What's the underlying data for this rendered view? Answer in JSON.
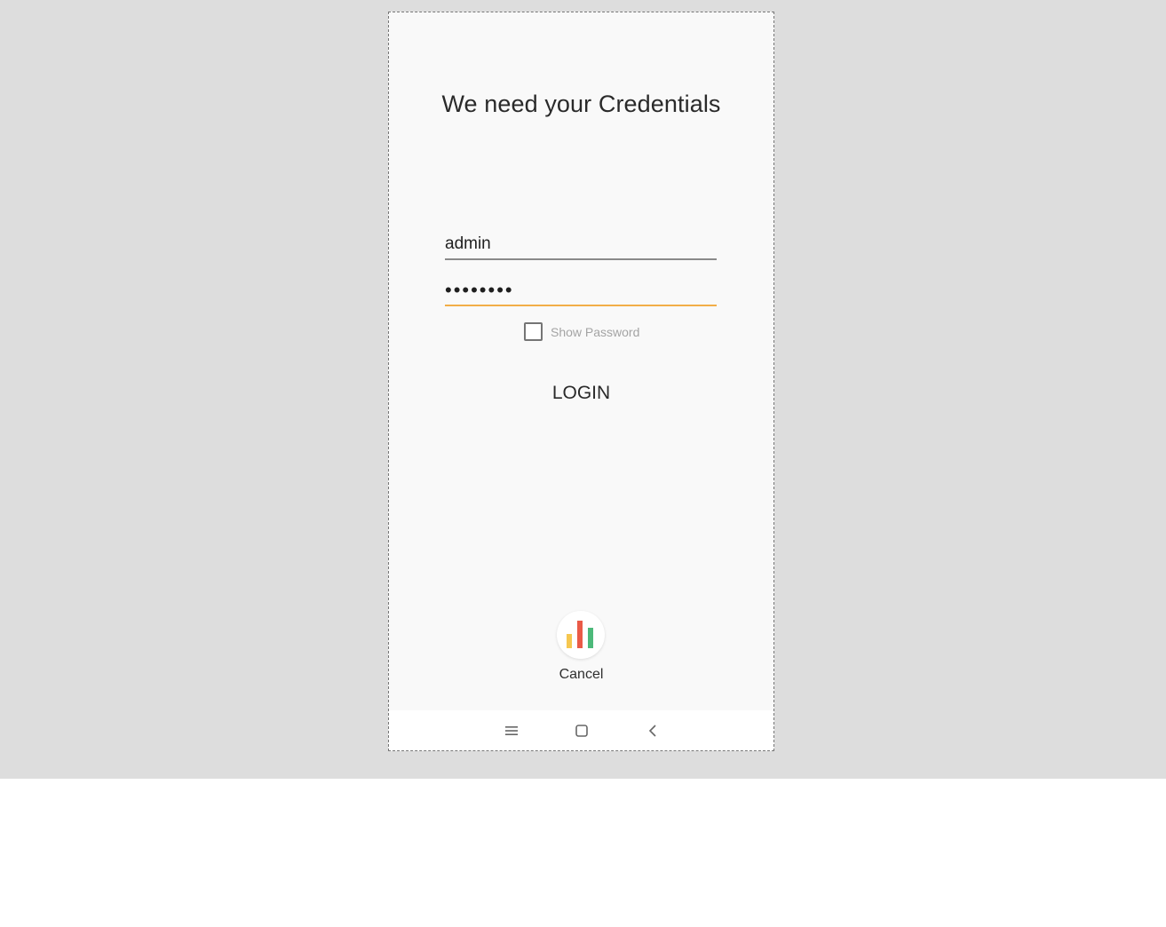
{
  "screen": {
    "title": "We need your Credentials"
  },
  "form": {
    "username_value": "admin",
    "password_value": "secret12",
    "show_password_label": "Show Password",
    "show_password_checked": false,
    "login_label": "LOGIN"
  },
  "footer": {
    "cancel_label": "Cancel",
    "app_icon": "bar-chart-icon"
  },
  "navbar": {
    "icons": [
      "recents-icon",
      "home-icon",
      "back-icon"
    ]
  },
  "colors": {
    "accent": "#f2ae48",
    "background": "#f9f9f9",
    "backdrop": "#dddddd",
    "bar_yellow": "#f6c74f",
    "bar_red": "#ea5a47",
    "bar_green": "#4cb97a"
  }
}
